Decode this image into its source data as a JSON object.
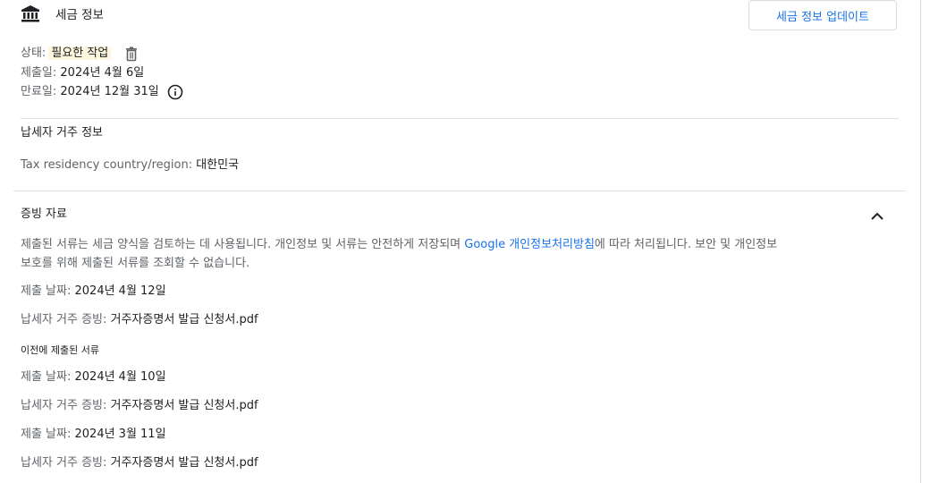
{
  "tax_info": {
    "title": "세금 정보",
    "update_button": "세금 정보 업데이트",
    "status_label": "상태:",
    "status_value": "필요한 작업",
    "submitted_label": "제출일:",
    "submitted_value": "2024년 4월 6일",
    "expiry_label": "만료일:",
    "expiry_value": "2024년 12월 31일"
  },
  "residency": {
    "title": "납세자 거주 정보",
    "country_label": "Tax residency country/region:",
    "country_value": "대한민국"
  },
  "documents": {
    "title": "증빙 자료",
    "desc_before": "제출된 서류는 세금 양식을 검토하는 데 사용됩니다. 개인정보 및 서류는 안전하게 저장되며 ",
    "desc_link": "Google 개인정보처리방침",
    "desc_after_line1": "에 따라 처리됩니다. 보안 및 개인정보",
    "desc_line2": "보호를 위해 제출된 서류를 조회할 수 없습니다.",
    "current": {
      "date_label": "제출 날짜:",
      "date_value": "2024년 4월 12일",
      "proof_label": "납세자 거주 증빙:",
      "proof_value": "거주자증명서 발급 신청서.pdf"
    },
    "previous_title": "이전에 제출된 서류",
    "previous": [
      {
        "date_label": "제출 날짜:",
        "date_value": "2024년 4월 10일",
        "proof_label": "납세자 거주 증빙:",
        "proof_value": "거주자증명서 발급 신청서.pdf"
      },
      {
        "date_label": "제출 날짜:",
        "date_value": "2024년 3월 11일",
        "proof_label": "납세자 거주 증빙:",
        "proof_value": "거주자증명서 발급 신청서.pdf"
      }
    ]
  },
  "icons": {
    "bank": "bank-icon",
    "trash": "trash-icon",
    "info": "info-icon",
    "chevron": "chevron-up-icon"
  },
  "colors": {
    "link": "#1a73e8",
    "status_highlight": "#fef7e0",
    "label": "#5f6368",
    "text": "#202124"
  }
}
